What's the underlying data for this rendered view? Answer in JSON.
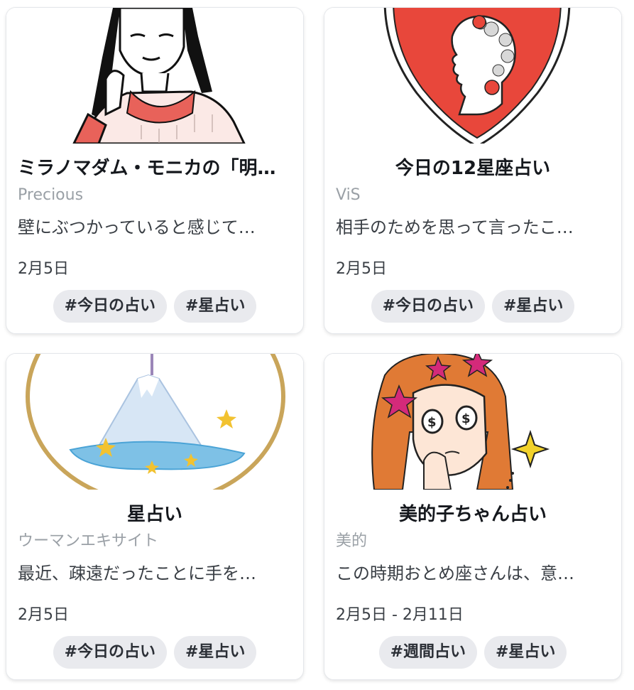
{
  "cards": [
    {
      "title": "ミラノマダム・モニカの「明…",
      "source": "Precious",
      "description": "壁にぶつかっていると感じて…",
      "date": "2月5日",
      "tags": [
        "#今日の占い",
        "#星占い"
      ],
      "image_icon": "woman-illustration-icon"
    },
    {
      "title": "今日の12星座占い",
      "source": "ViS",
      "description": "相手のためを思って言ったこ…",
      "date": "2月5日",
      "tags": [
        "#今日の占い",
        "#星占い"
      ],
      "image_icon": "heart-cameo-icon"
    },
    {
      "title": "星占い",
      "source": "ウーマンエキサイト",
      "description": "最近、疎遠だったことに手を…",
      "date": "2月5日",
      "tags": [
        "#今日の占い",
        "#星占い"
      ],
      "image_icon": "mountain-stars-icon"
    },
    {
      "title": "美的子ちゃん占い",
      "source": "美的",
      "description": "この時期おとめ座さんは、意…",
      "date": "2月5日 - 2月11日",
      "tags": [
        "#週間占い",
        "#星占い"
      ],
      "image_icon": "cartoon-girl-icon"
    }
  ],
  "colors": {
    "tag_bg": "#e9eaee",
    "source_text": "#9aa0a6",
    "heart_red": "#e8473b",
    "sweater_red": "#e8625a",
    "hair_orange": "#e07a35",
    "star_magenta": "#d42a7a"
  }
}
